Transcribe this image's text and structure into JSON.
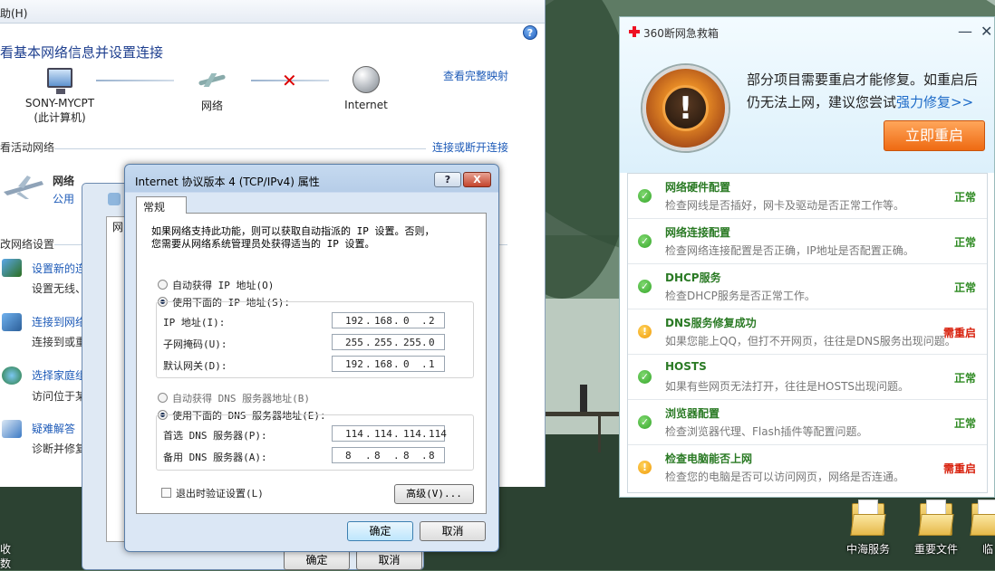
{
  "network_center": {
    "menu_help": "助(H)",
    "title": "看基本网络信息并设置连接",
    "map_link": "查看完整映射",
    "nodes": {
      "computer_name": "SONY-MYCPT",
      "computer_sub": "(此计算机)",
      "network": "网络",
      "internet": "Internet"
    },
    "active_section": "看活动网络",
    "connect_link": "连接或断开连接",
    "active_network_name": "网络",
    "active_network_type": "公用",
    "change_section": "改网络设置",
    "tasks": [
      {
        "title": "设置新的连",
        "desc": "设置无线、"
      },
      {
        "title": "连接到网络",
        "desc": "连接到或重"
      },
      {
        "title": "选择家庭组",
        "desc": "访问位于某"
      },
      {
        "title": "疑难解答",
        "desc": "诊断并修复"
      }
    ]
  },
  "background_dialog": {
    "tab_fragment": "网",
    "ok": "确定",
    "cancel": "取消"
  },
  "tcp_dialog": {
    "title": "Internet 协议版本 4 (TCP/IPv4) 属性",
    "help_btn": "?",
    "close_btn": "X",
    "tab": "常规",
    "desc_line1": "如果网络支持此功能，则可以获取自动指派的 IP 设置。否则，",
    "desc_line2": "您需要从网络系统管理员处获得适当的 IP 设置。",
    "auto_ip": "自动获得 IP 地址(O)",
    "manual_ip": "使用下面的 IP 地址(S):",
    "ip_label": "IP 地址(I):",
    "mask_label": "子网掩码(U):",
    "gateway_label": "默认网关(D):",
    "ip": [
      "192",
      "168",
      "0",
      "2"
    ],
    "mask": [
      "255",
      "255",
      "255",
      "0"
    ],
    "gateway": [
      "192",
      "168",
      "0",
      "1"
    ],
    "auto_dns": "自动获得 DNS 服务器地址(B)",
    "manual_dns": "使用下面的 DNS 服务器地址(E):",
    "dns1_label": "首选 DNS 服务器(P):",
    "dns2_label": "备用 DNS 服务器(A):",
    "dns1": [
      "114",
      "114",
      "114",
      "114"
    ],
    "dns2": [
      "8",
      "8",
      "8",
      "8"
    ],
    "validate": "退出时验证设置(L)",
    "advanced": "高级(V)...",
    "ok": "确定",
    "cancel": "取消"
  },
  "panel_360": {
    "title": "360断网急救箱",
    "minimize": "—",
    "close": "✕",
    "message": "部分项目需要重启才能修复。如重启后仍无法上网，建议您尝试",
    "force_link": "强力修复>>",
    "restart_btn": "立即重启",
    "items": [
      {
        "name": "网络硬件配置",
        "hint": "检查网线是否插好，网卡及驱动是否正常工作等。",
        "status": "正常",
        "state": "ok"
      },
      {
        "name": "网络连接配置",
        "hint": "检查网络连接配置是否正确，IP地址是否配置正确。",
        "status": "正常",
        "state": "ok"
      },
      {
        "name": "DHCP服务",
        "hint": "检查DHCP服务是否正常工作。",
        "status": "正常",
        "state": "ok"
      },
      {
        "name": "DNS服务修复成功",
        "hint": "如果您能上QQ，但打不开网页，往往是DNS服务出现问题。",
        "status": "需重启",
        "state": "warn"
      },
      {
        "name": "HOSTS",
        "hint": "如果有些网页无法打开，往往是HOSTS出现问题。",
        "status": "正常",
        "state": "ok"
      },
      {
        "name": "浏览器配置",
        "hint": "检查浏览器代理、Flash插件等配置问题。",
        "status": "正常",
        "state": "ok"
      },
      {
        "name": "检查电脑能否上网",
        "hint": "检查您的电脑是否可以访问网页，网络是否连通。",
        "status": "需重启",
        "state": "warn"
      }
    ]
  },
  "desktop": {
    "icons": [
      "中海服务",
      "重要文件",
      "临"
    ],
    "left_labels": [
      "收",
      "数"
    ]
  }
}
